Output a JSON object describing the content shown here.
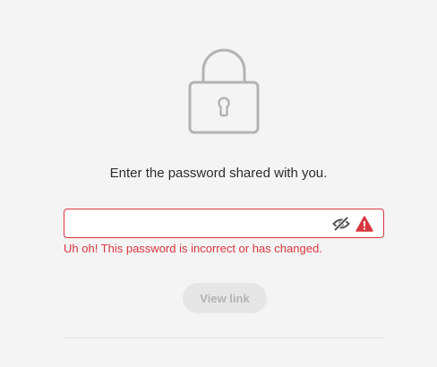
{
  "prompt": {
    "text": "Enter the password shared with you."
  },
  "password_field": {
    "value": "",
    "placeholder": "",
    "state": "error"
  },
  "error": {
    "message": "Uh oh! This password is incorrect or has changed."
  },
  "actions": {
    "view_link_label": "View link",
    "view_link_enabled": false
  },
  "icons": {
    "lock": "lock-icon",
    "toggle": "eye-off-icon",
    "alert": "alert-icon"
  },
  "colors": {
    "error": "#d7373f",
    "icon_gray": "#b3b3b3",
    "button_disabled_bg": "#e6e6e6",
    "button_disabled_text": "#b3b3b3",
    "background": "#f4f4f4"
  }
}
